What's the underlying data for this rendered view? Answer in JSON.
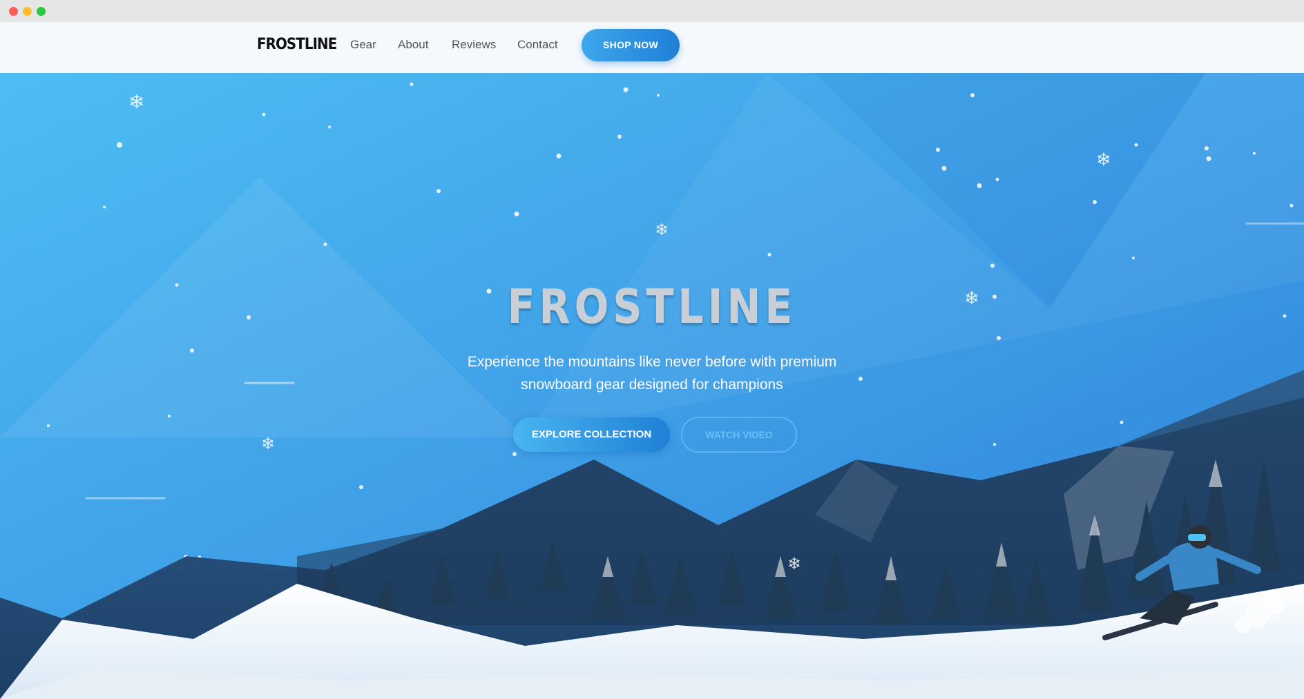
{
  "nav": {
    "logo": "FROSTLINE",
    "links": [
      "Gear",
      "About",
      "Reviews",
      "Contact"
    ],
    "cta_label": "SHOP NOW"
  },
  "hero": {
    "title": "FROSTLINE",
    "subtitle": "Experience the mountains like never before with premium snowboard gear designed for champions",
    "primary_button": "EXPLORE COLLECTION",
    "secondary_button": "WATCH VIDEO",
    "image_alt": "snowboarder-on-snowy-mountain-slope"
  },
  "colors": {
    "accent": "#1e7fd6",
    "accent_light": "#3ea7ec",
    "hero_top": "#48bbf2",
    "hero_bottom": "#2d83dc"
  },
  "icons": [
    "snowflake-icon"
  ]
}
